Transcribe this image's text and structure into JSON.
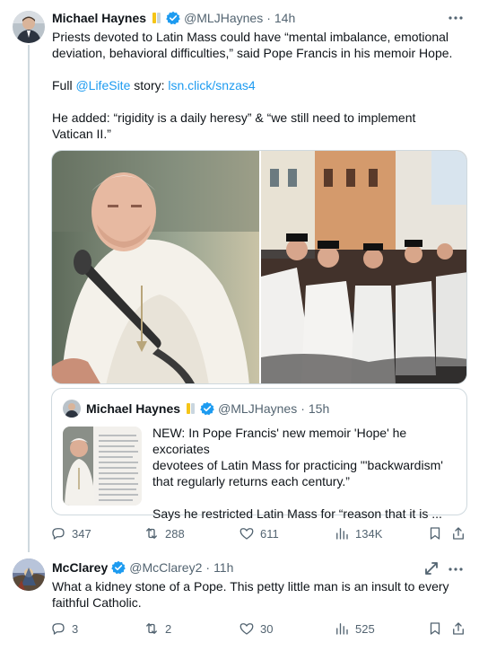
{
  "tweet1": {
    "author_name": "Michael Haynes",
    "handle": "@MLJHaynes",
    "separator": "·",
    "time": "14h",
    "text_line1": "Priests devoted to Latin Mass could have “mental imbalance, emotional",
    "text_line2": "deviation, behavioral difficulties,” said Pope Francis in his memoir Hope.",
    "full_prefix": "Full ",
    "mention": "@LifeSite",
    "story_label": " story: ",
    "link": "lsn.click/snzas4",
    "text_line4": "He added: “rigidity is a daily heresy” & “we still need to implement",
    "text_line5": "Vatican II.”",
    "quote": {
      "author_name": "Michael Haynes",
      "handle": "@MLJHaynes",
      "separator": "·",
      "time": "15h",
      "text_line1": "NEW: In Pope Francis' new memoir 'Hope' he excoriates",
      "text_line2": "devotees of Latin Mass for practicing \"'backwardism'",
      "text_line3": "that regularly returns each century.”",
      "text_line4": "Says he restricted Latin Mass for “reason that it is ..."
    },
    "actions": {
      "replies": "347",
      "reposts": "288",
      "likes": "611",
      "views": "134K"
    }
  },
  "tweet2": {
    "author_name": "McClarey",
    "handle": "@McClarey2",
    "separator": "·",
    "time": "11h",
    "text_line1": "What a kidney stone of a Pope.  This petty little man is an insult to every",
    "text_line2": "faithful Catholic.",
    "actions": {
      "replies": "3",
      "reposts": "2",
      "likes": "30",
      "views": "525"
    }
  },
  "colors": {
    "text": "#0f1419",
    "secondary": "#536471",
    "link": "#1d9bf0",
    "border": "#cfd9de",
    "verified": "#1d9bf0",
    "gold_badge": "#f5c518"
  },
  "icons": [
    "more-icon",
    "verified-icon",
    "gold-badge-icon",
    "reply-icon",
    "repost-icon",
    "like-icon",
    "views-icon",
    "bookmark-icon",
    "share-icon",
    "grok-icon"
  ]
}
